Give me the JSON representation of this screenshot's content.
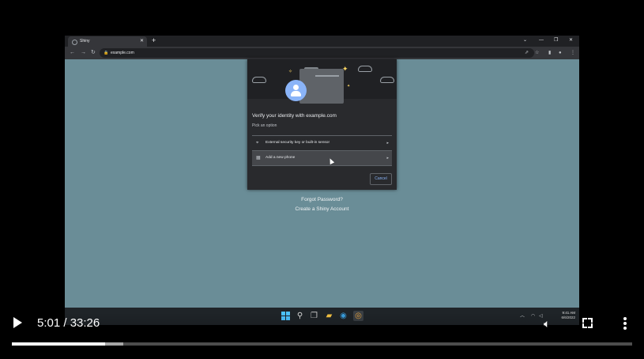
{
  "browser": {
    "tab_title": "Shiny",
    "url": "example.com"
  },
  "dialog": {
    "title": "Verify your identity with example.com",
    "subtitle": "Pick an option",
    "options": [
      {
        "label": "External security key or built-in sensor",
        "icon": "fingerprint-icon"
      },
      {
        "label": "Add a new phone",
        "icon": "qr-code-icon"
      }
    ],
    "cancel_label": "Cancel"
  },
  "page": {
    "forgot_password": "Forgot Password?",
    "create_account": "Create a Shiny Account"
  },
  "taskbar": {
    "time": "9:41 AM",
    "date": "6/6/2022"
  },
  "player": {
    "current_time": "5:01",
    "separator": "/",
    "duration": "33:26",
    "time_display": "5:01 / 33:26",
    "played_fraction": 0.15,
    "buffered_fraction": 0.18
  },
  "colors": {
    "page_bg": "#6a8d97",
    "accent": "#8ab4f8",
    "dialog_bg": "#292a2d"
  }
}
